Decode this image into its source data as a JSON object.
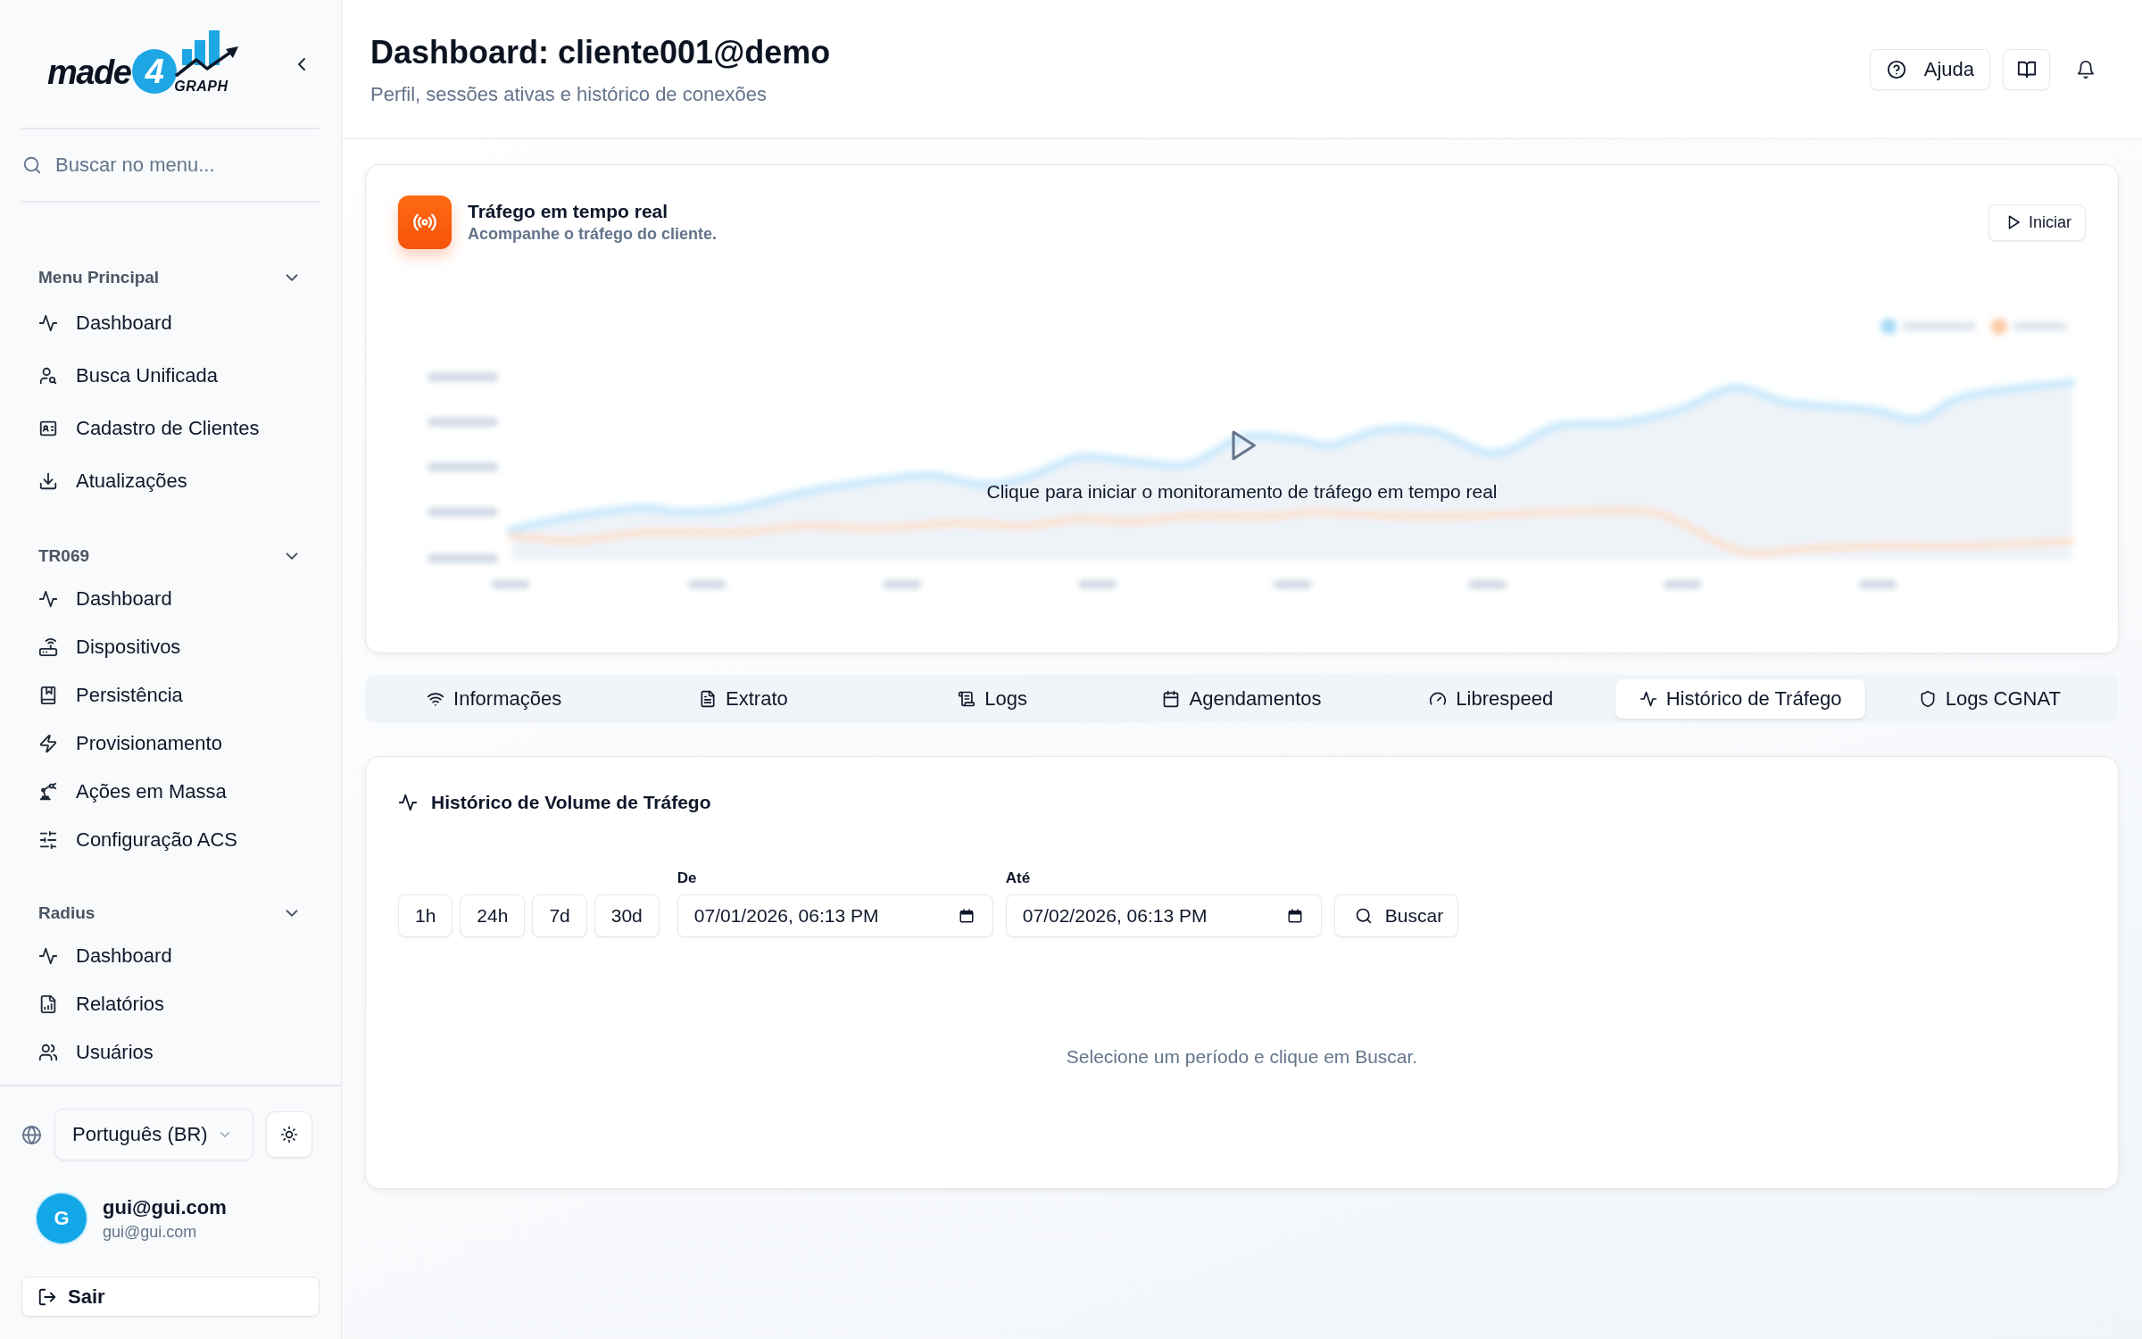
{
  "sidebar": {
    "logo": {
      "word": "made",
      "digit": "4",
      "tagline": "GRAPH"
    },
    "search": {
      "placeholder": "Buscar no menu..."
    },
    "sections": [
      {
        "title": "Menu Principal",
        "expanded": true,
        "items": [
          {
            "label": "Dashboard"
          },
          {
            "label": "Busca Unificada"
          },
          {
            "label": "Cadastro de Clientes"
          },
          {
            "label": "Atualizações"
          }
        ]
      },
      {
        "title": "TR069",
        "expanded": true,
        "items": [
          {
            "label": "Dashboard"
          },
          {
            "label": "Dispositivos"
          },
          {
            "label": "Persistência"
          },
          {
            "label": "Provisionamento"
          },
          {
            "label": "Ações em Massa"
          },
          {
            "label": "Configuração ACS"
          }
        ]
      },
      {
        "title": "Radius",
        "expanded": true,
        "items": [
          {
            "label": "Dashboard"
          },
          {
            "label": "Relatórios"
          },
          {
            "label": "Usuários"
          }
        ]
      }
    ],
    "language": {
      "value": "Português (BR)"
    },
    "user": {
      "initial": "G",
      "name": "gui@gui.com",
      "email": "gui@gui.com"
    },
    "logout_button": {
      "label": "Sair"
    }
  },
  "header": {
    "title": "Dashboard: cliente001@demo",
    "subtitle": "Perfil, sessões ativas e histórico de conexões",
    "help_button": {
      "label": "Ajuda"
    }
  },
  "realtime_card": {
    "title": "Tráfego em tempo real",
    "subtitle": "Acompanhe o tráfego do cliente.",
    "start_button": {
      "label": "Iniciar"
    },
    "overlay_message": "Clique para iniciar o monitoramento de tráfego em tempo real"
  },
  "tabs": [
    {
      "label": "Informações",
      "selected": false
    },
    {
      "label": "Extrato",
      "selected": false
    },
    {
      "label": "Logs",
      "selected": false
    },
    {
      "label": "Agendamentos",
      "selected": false
    },
    {
      "label": "Librespeed",
      "selected": false
    },
    {
      "label": "Histórico de Tráfego",
      "selected": true
    },
    {
      "label": "Logs CGNAT",
      "selected": false
    }
  ],
  "history_card": {
    "title": "Histórico de Volume de Tráfego",
    "presets": [
      {
        "label": "1h"
      },
      {
        "label": "24h"
      },
      {
        "label": "7d"
      },
      {
        "label": "30d"
      }
    ],
    "from_field": {
      "label": "De",
      "value": "07/01/2026, 06:13 PM"
    },
    "to_field": {
      "label": "Até",
      "value": "07/02/2026, 06:13 PM"
    },
    "search_button": {
      "label": "Buscar"
    },
    "empty_message": "Selecione um período e clique em Buscar."
  }
}
